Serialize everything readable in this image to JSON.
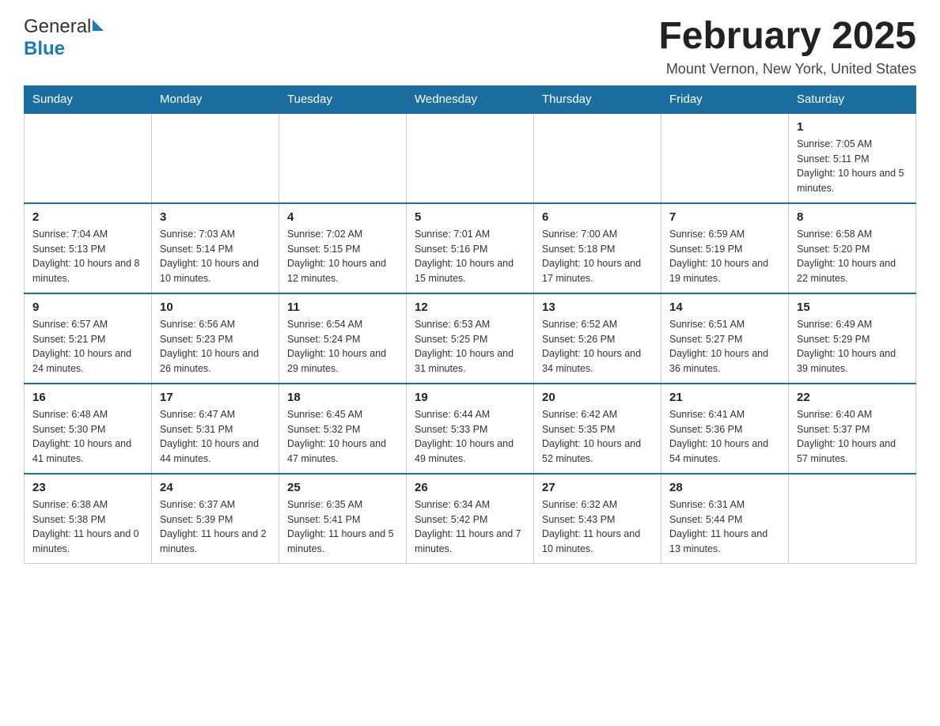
{
  "header": {
    "logo": {
      "general": "General",
      "blue": "Blue"
    },
    "title": "February 2025",
    "location": "Mount Vernon, New York, United States"
  },
  "weekdays": [
    "Sunday",
    "Monday",
    "Tuesday",
    "Wednesday",
    "Thursday",
    "Friday",
    "Saturday"
  ],
  "weeks": [
    [
      {
        "day": "",
        "sunrise": "",
        "sunset": "",
        "daylight": ""
      },
      {
        "day": "",
        "sunrise": "",
        "sunset": "",
        "daylight": ""
      },
      {
        "day": "",
        "sunrise": "",
        "sunset": "",
        "daylight": ""
      },
      {
        "day": "",
        "sunrise": "",
        "sunset": "",
        "daylight": ""
      },
      {
        "day": "",
        "sunrise": "",
        "sunset": "",
        "daylight": ""
      },
      {
        "day": "",
        "sunrise": "",
        "sunset": "",
        "daylight": ""
      },
      {
        "day": "1",
        "sunrise": "Sunrise: 7:05 AM",
        "sunset": "Sunset: 5:11 PM",
        "daylight": "Daylight: 10 hours and 5 minutes."
      }
    ],
    [
      {
        "day": "2",
        "sunrise": "Sunrise: 7:04 AM",
        "sunset": "Sunset: 5:13 PM",
        "daylight": "Daylight: 10 hours and 8 minutes."
      },
      {
        "day": "3",
        "sunrise": "Sunrise: 7:03 AM",
        "sunset": "Sunset: 5:14 PM",
        "daylight": "Daylight: 10 hours and 10 minutes."
      },
      {
        "day": "4",
        "sunrise": "Sunrise: 7:02 AM",
        "sunset": "Sunset: 5:15 PM",
        "daylight": "Daylight: 10 hours and 12 minutes."
      },
      {
        "day": "5",
        "sunrise": "Sunrise: 7:01 AM",
        "sunset": "Sunset: 5:16 PM",
        "daylight": "Daylight: 10 hours and 15 minutes."
      },
      {
        "day": "6",
        "sunrise": "Sunrise: 7:00 AM",
        "sunset": "Sunset: 5:18 PM",
        "daylight": "Daylight: 10 hours and 17 minutes."
      },
      {
        "day": "7",
        "sunrise": "Sunrise: 6:59 AM",
        "sunset": "Sunset: 5:19 PM",
        "daylight": "Daylight: 10 hours and 19 minutes."
      },
      {
        "day": "8",
        "sunrise": "Sunrise: 6:58 AM",
        "sunset": "Sunset: 5:20 PM",
        "daylight": "Daylight: 10 hours and 22 minutes."
      }
    ],
    [
      {
        "day": "9",
        "sunrise": "Sunrise: 6:57 AM",
        "sunset": "Sunset: 5:21 PM",
        "daylight": "Daylight: 10 hours and 24 minutes."
      },
      {
        "day": "10",
        "sunrise": "Sunrise: 6:56 AM",
        "sunset": "Sunset: 5:23 PM",
        "daylight": "Daylight: 10 hours and 26 minutes."
      },
      {
        "day": "11",
        "sunrise": "Sunrise: 6:54 AM",
        "sunset": "Sunset: 5:24 PM",
        "daylight": "Daylight: 10 hours and 29 minutes."
      },
      {
        "day": "12",
        "sunrise": "Sunrise: 6:53 AM",
        "sunset": "Sunset: 5:25 PM",
        "daylight": "Daylight: 10 hours and 31 minutes."
      },
      {
        "day": "13",
        "sunrise": "Sunrise: 6:52 AM",
        "sunset": "Sunset: 5:26 PM",
        "daylight": "Daylight: 10 hours and 34 minutes."
      },
      {
        "day": "14",
        "sunrise": "Sunrise: 6:51 AM",
        "sunset": "Sunset: 5:27 PM",
        "daylight": "Daylight: 10 hours and 36 minutes."
      },
      {
        "day": "15",
        "sunrise": "Sunrise: 6:49 AM",
        "sunset": "Sunset: 5:29 PM",
        "daylight": "Daylight: 10 hours and 39 minutes."
      }
    ],
    [
      {
        "day": "16",
        "sunrise": "Sunrise: 6:48 AM",
        "sunset": "Sunset: 5:30 PM",
        "daylight": "Daylight: 10 hours and 41 minutes."
      },
      {
        "day": "17",
        "sunrise": "Sunrise: 6:47 AM",
        "sunset": "Sunset: 5:31 PM",
        "daylight": "Daylight: 10 hours and 44 minutes."
      },
      {
        "day": "18",
        "sunrise": "Sunrise: 6:45 AM",
        "sunset": "Sunset: 5:32 PM",
        "daylight": "Daylight: 10 hours and 47 minutes."
      },
      {
        "day": "19",
        "sunrise": "Sunrise: 6:44 AM",
        "sunset": "Sunset: 5:33 PM",
        "daylight": "Daylight: 10 hours and 49 minutes."
      },
      {
        "day": "20",
        "sunrise": "Sunrise: 6:42 AM",
        "sunset": "Sunset: 5:35 PM",
        "daylight": "Daylight: 10 hours and 52 minutes."
      },
      {
        "day": "21",
        "sunrise": "Sunrise: 6:41 AM",
        "sunset": "Sunset: 5:36 PM",
        "daylight": "Daylight: 10 hours and 54 minutes."
      },
      {
        "day": "22",
        "sunrise": "Sunrise: 6:40 AM",
        "sunset": "Sunset: 5:37 PM",
        "daylight": "Daylight: 10 hours and 57 minutes."
      }
    ],
    [
      {
        "day": "23",
        "sunrise": "Sunrise: 6:38 AM",
        "sunset": "Sunset: 5:38 PM",
        "daylight": "Daylight: 11 hours and 0 minutes."
      },
      {
        "day": "24",
        "sunrise": "Sunrise: 6:37 AM",
        "sunset": "Sunset: 5:39 PM",
        "daylight": "Daylight: 11 hours and 2 minutes."
      },
      {
        "day": "25",
        "sunrise": "Sunrise: 6:35 AM",
        "sunset": "Sunset: 5:41 PM",
        "daylight": "Daylight: 11 hours and 5 minutes."
      },
      {
        "day": "26",
        "sunrise": "Sunrise: 6:34 AM",
        "sunset": "Sunset: 5:42 PM",
        "daylight": "Daylight: 11 hours and 7 minutes."
      },
      {
        "day": "27",
        "sunrise": "Sunrise: 6:32 AM",
        "sunset": "Sunset: 5:43 PM",
        "daylight": "Daylight: 11 hours and 10 minutes."
      },
      {
        "day": "28",
        "sunrise": "Sunrise: 6:31 AM",
        "sunset": "Sunset: 5:44 PM",
        "daylight": "Daylight: 11 hours and 13 minutes."
      },
      {
        "day": "",
        "sunrise": "",
        "sunset": "",
        "daylight": ""
      }
    ]
  ]
}
